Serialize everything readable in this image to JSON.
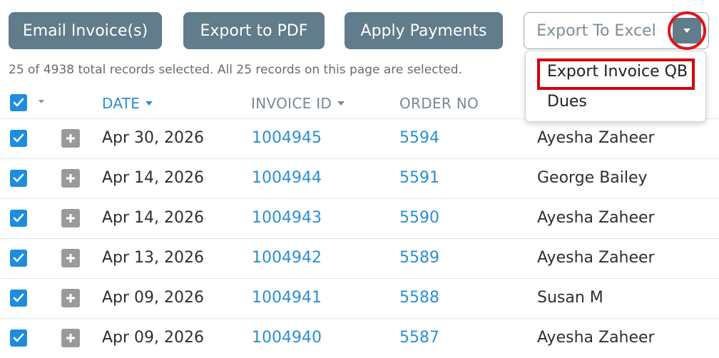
{
  "toolbar": {
    "email_label": "Email Invoice(s)",
    "pdf_label": "Export to PDF",
    "apply_label": "Apply Payments",
    "excel_label": "Export To Excel"
  },
  "selection_status": "25 of 4938 total records selected. All 25 records on this page are selected.",
  "export_menu": {
    "items": [
      {
        "label": "Export Invoice QB",
        "highlighted": true
      },
      {
        "label": "Dues",
        "highlighted": false
      }
    ]
  },
  "table": {
    "columns": {
      "date": "DATE",
      "invoice_id": "INVOICE ID",
      "order_no": "ORDER NO"
    },
    "rows": [
      {
        "date": "Apr 30, 2026",
        "invoice_id": "1004945",
        "order_no": "5594",
        "customer": "Ayesha Zaheer",
        "checked": true
      },
      {
        "date": "Apr 14, 2026",
        "invoice_id": "1004944",
        "order_no": "5591",
        "customer": "George Bailey",
        "checked": true
      },
      {
        "date": "Apr 14, 2026",
        "invoice_id": "1004943",
        "order_no": "5590",
        "customer": "Ayesha Zaheer",
        "checked": true
      },
      {
        "date": "Apr 13, 2026",
        "invoice_id": "1004942",
        "order_no": "5589",
        "customer": "Ayesha Zaheer",
        "checked": true
      },
      {
        "date": "Apr 09, 2026",
        "invoice_id": "1004941",
        "order_no": "5588",
        "customer": "Susan M",
        "checked": true
      },
      {
        "date": "Apr 09, 2026",
        "invoice_id": "1004940",
        "order_no": "5587",
        "customer": "Ayesha Zaheer",
        "checked": true
      }
    ]
  },
  "icons": {
    "checkbox": "checkbox-checked-icon",
    "expand": "plus-square-icon",
    "caret": "caret-down-icon"
  },
  "colors": {
    "button_bg": "#617c8b",
    "link_blue": "#2a8fd0",
    "checkbox_blue": "#1d8ddf",
    "annotation_red": "#e0151b"
  }
}
